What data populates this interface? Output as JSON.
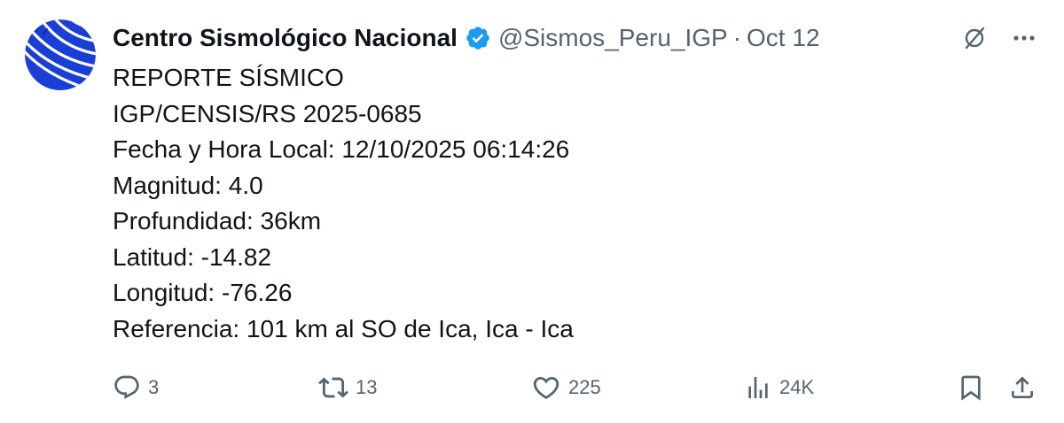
{
  "author": {
    "display_name": "Centro Sismológico Nacional",
    "handle": "@Sismos_Peru_IGP",
    "separator": "·",
    "date": "Oct 12",
    "verified": true
  },
  "tweet": {
    "lines": [
      "REPORTE SÍSMICO",
      "IGP/CENSIS/RS 2025-0685",
      "Fecha y Hora Local: 12/10/2025 06:14:26",
      "Magnitud: 4.0",
      "Profundidad: 36km",
      "Latitud: -14.82",
      "Longitud: -76.26",
      "Referencia: 101 km al SO de Ica, Ica - Ica"
    ]
  },
  "actions": {
    "replies": "3",
    "reposts": "13",
    "likes": "225",
    "views": "24K"
  },
  "icons": {
    "avatar": "igp-logo-avatar",
    "verified": "verified-badge-icon",
    "grok": "grok-icon",
    "more": "more-icon",
    "reply": "reply-icon",
    "repost": "repost-icon",
    "like": "heart-icon",
    "views": "views-icon",
    "bookmark": "bookmark-icon",
    "share": "share-icon"
  },
  "colors": {
    "text_primary": "#0f1419",
    "text_secondary": "#536471",
    "verified_blue": "#1d9bf0",
    "avatar_blue": "#1a3fd6"
  }
}
